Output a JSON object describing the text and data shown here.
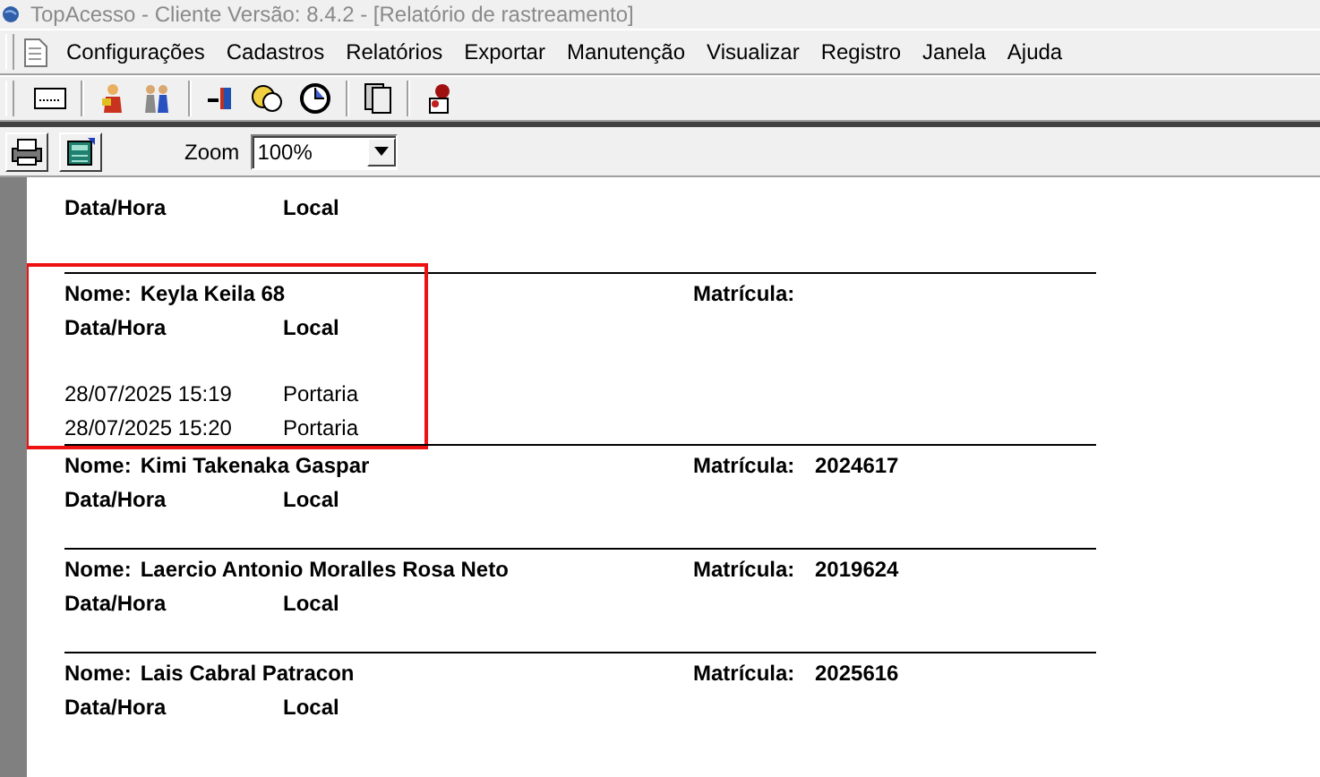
{
  "window": {
    "title": "TopAcesso - Cliente Versão: 8.4.2 - [Relatório de rastreamento]"
  },
  "menu": [
    "Configurações",
    "Cadastros",
    "Relatórios",
    "Exportar",
    "Manutenção",
    "Visualizar",
    "Registro",
    "Janela",
    "Ajuda"
  ],
  "preview_toolbar": {
    "zoom_label": "Zoom",
    "zoom_value": "100%"
  },
  "report": {
    "records": [
      {
        "columns": [
          "Data/Hora",
          "Local"
        ]
      },
      {
        "name_label": "Nome:",
        "name": "Keyla Keila 68",
        "matricula_label": "Matrícula:",
        "columns": [
          "Data/Hora",
          "Local"
        ],
        "entries": [
          {
            "datetime": "28/07/2025 15:19",
            "local": "Portaria"
          },
          {
            "datetime": "28/07/2025 15:20",
            "local": "Portaria"
          }
        ],
        "highlighted": true
      },
      {
        "name_label": "Nome:",
        "name": "Kimi Takenaka Gaspar",
        "matricula_label": "Matrícula:",
        "matricula": "2024617",
        "columns": [
          "Data/Hora",
          "Local"
        ],
        "highlighted": false
      },
      {
        "name_label": "Nome:",
        "name": "Laercio Antonio Moralles Rosa Neto",
        "matricula_label": "Matrícula:",
        "matricula": "2019624",
        "columns": [
          "Data/Hora",
          "Local"
        ],
        "highlighted": false
      },
      {
        "name_label": "Nome:",
        "name": "Lais Cabral Patracon",
        "matricula_label": "Matrícula:",
        "matricula": "2025616",
        "columns": [
          "Data/Hora",
          "Local"
        ],
        "highlighted": false
      }
    ]
  }
}
